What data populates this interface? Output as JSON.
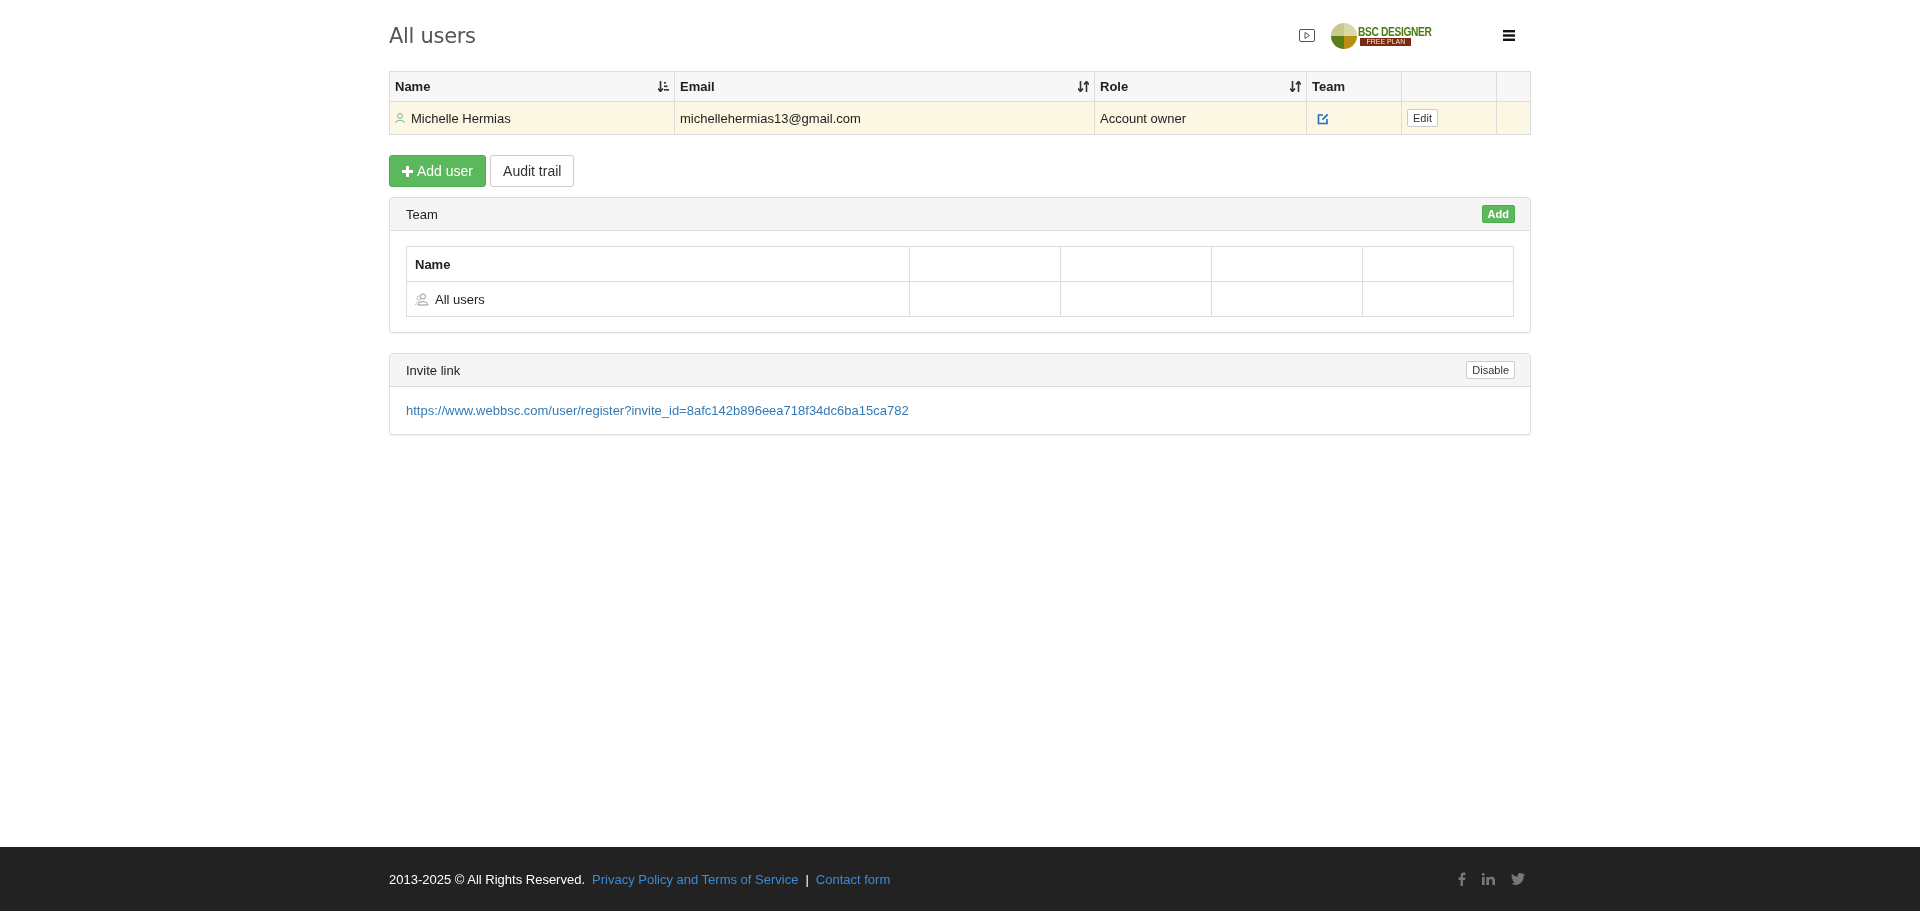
{
  "header": {
    "title": "All users",
    "logo": {
      "name": "BSC DESIGNER",
      "plan": "FREE PLAN"
    }
  },
  "users_table": {
    "columns": [
      {
        "label": "Name",
        "kind": "sorted"
      },
      {
        "label": "Email",
        "kind": "sortable"
      },
      {
        "label": "Role",
        "kind": "sortable"
      },
      {
        "label": "Team",
        "kind": "plain"
      }
    ],
    "rows": [
      {
        "name": "Michelle Hermias",
        "email": "michellehermias13@gmail.com",
        "role": "Account owner",
        "action": "Edit"
      }
    ]
  },
  "actions": [
    {
      "label": "Add user",
      "kind": "primary"
    },
    {
      "label": "Audit trail",
      "kind": "default"
    }
  ],
  "team_panel": {
    "title": "Team",
    "button": "Add",
    "table": {
      "header": "Name",
      "rows": [
        {
          "name": "All users"
        }
      ]
    }
  },
  "invite_panel": {
    "title": "Invite link",
    "button": "Disable",
    "link": "https://www.webbsc.com/user/register?invite_id=8afc142b896eea718f34dc6ba15ca782"
  },
  "footer": {
    "copyright": "2013-2025 © All Rights Reserved.",
    "links": [
      "Privacy Policy and Terms of Service",
      "Contact form"
    ],
    "separator": "|"
  }
}
